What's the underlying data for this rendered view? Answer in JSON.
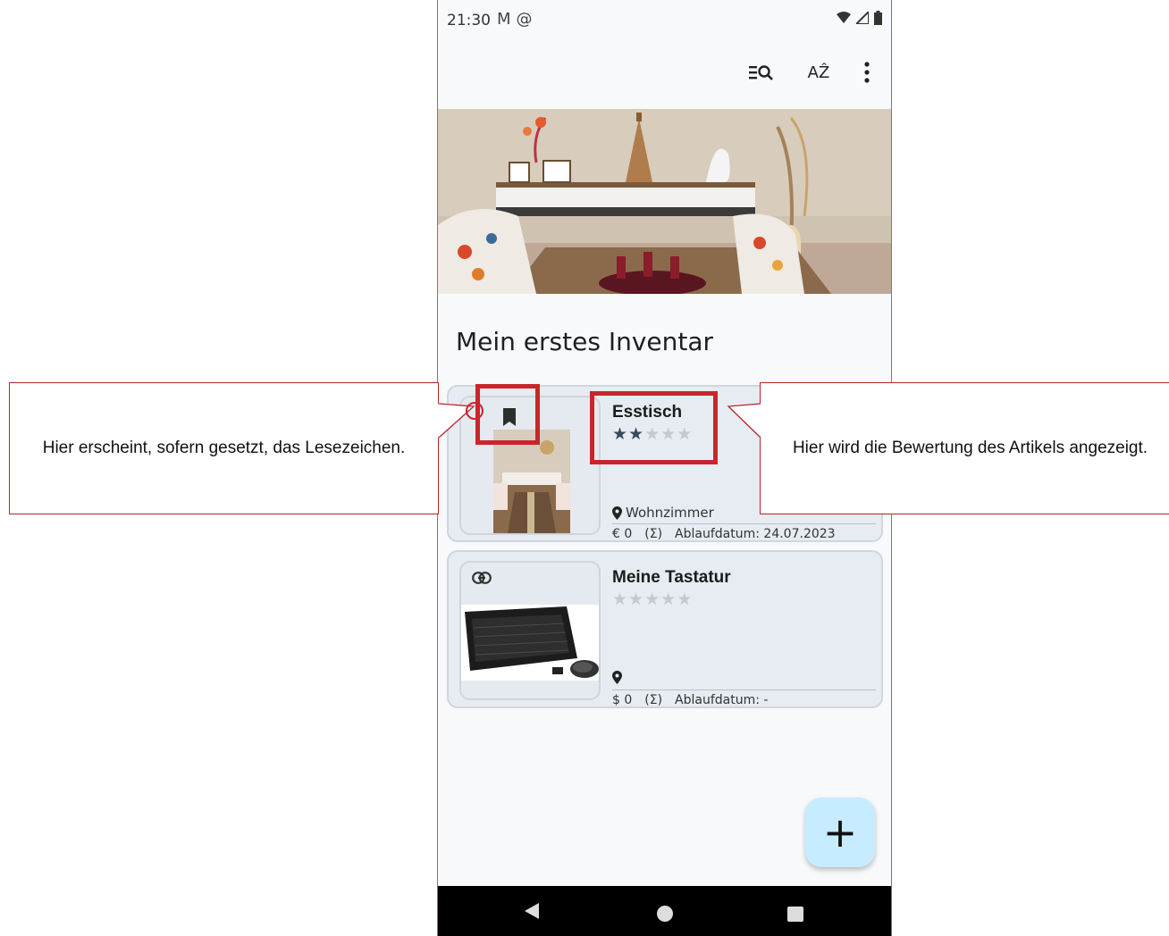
{
  "status_bar": {
    "time": "21:30",
    "left_icons": [
      "gmail-icon",
      "at-sign-icon"
    ],
    "right_icons": [
      "wifi-icon",
      "signal-icon",
      "battery-icon"
    ]
  },
  "app_bar": {
    "actions": [
      "search-filter-icon",
      "sort-az-icon",
      "more-vert-icon"
    ],
    "sort_label": "AẐ"
  },
  "inventory": {
    "title": "Mein erstes Inventar"
  },
  "items": [
    {
      "name": "Esstisch",
      "rating": 2,
      "max_rating": 5,
      "location": "Wohnzimmer",
      "price": "€ 0",
      "sum": "(Σ)",
      "expiry": "Ablaufdatum: 24.07.2023",
      "badge_icon": "bookmark-icon"
    },
    {
      "name": "Meine Tastatur",
      "rating": 0,
      "max_rating": 5,
      "location": "",
      "price": "$ 0",
      "sum": "(Σ)",
      "expiry": "Ablaufdatum: -",
      "badge_icon": "link-icon"
    }
  ],
  "fab": {
    "label": "+"
  },
  "annotations": {
    "left": "Hier erscheint, sofern gesetzt, das Lesezeichen.",
    "right": "Hier wird die Bewertung des Artikels angezeigt."
  },
  "colors": {
    "annotation": "#c8262c",
    "card_bg": "#e6ecf1",
    "fab_bg": "#c7ebff"
  }
}
